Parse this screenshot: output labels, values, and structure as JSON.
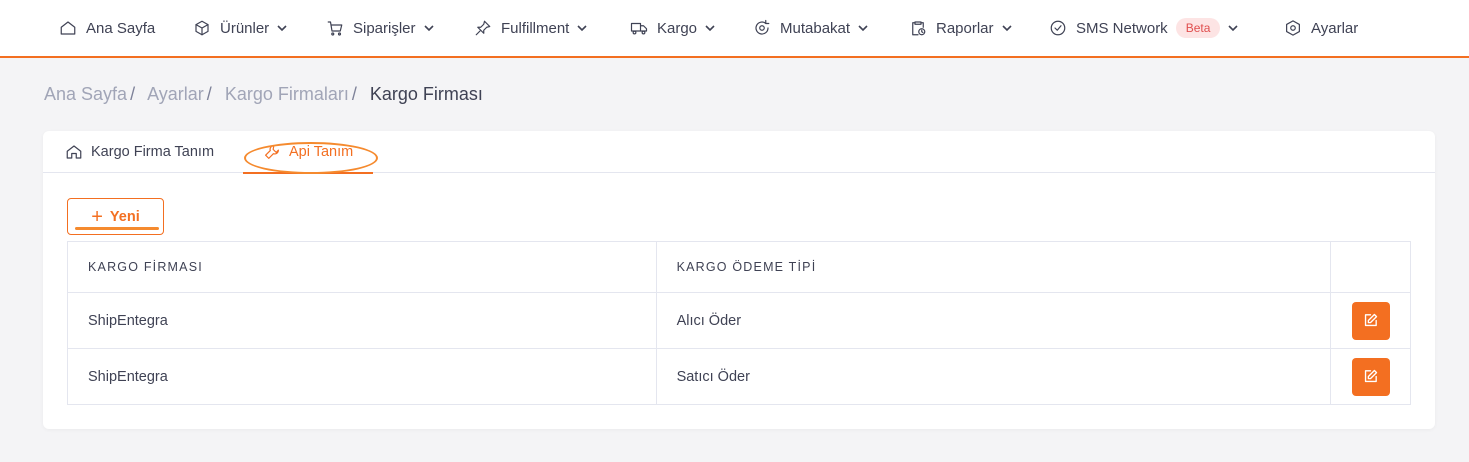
{
  "nav": {
    "items": [
      {
        "label": "Ana Sayfa",
        "icon": "home-icon",
        "dropdown": false
      },
      {
        "label": "Ürünler",
        "icon": "box-icon",
        "dropdown": true
      },
      {
        "label": "Siparişler",
        "icon": "cart-icon",
        "dropdown": true
      },
      {
        "label": "Fulfillment",
        "icon": "pin-icon",
        "dropdown": true
      },
      {
        "label": "Kargo",
        "icon": "truck-icon",
        "dropdown": true
      },
      {
        "label": "Mutabakat",
        "icon": "reconcile-icon",
        "dropdown": true
      },
      {
        "label": "Raporlar",
        "icon": "clipboard-icon",
        "dropdown": true
      },
      {
        "label": "SMS Network",
        "icon": "check-circle-icon",
        "dropdown": true,
        "badge": "Beta"
      },
      {
        "label": "Ayarlar",
        "icon": "settings-icon",
        "dropdown": false
      }
    ]
  },
  "breadcrumb": {
    "items": [
      "Ana Sayfa",
      "Ayarlar",
      "Kargo Firmaları"
    ],
    "current": "Kargo Firması"
  },
  "tabs": [
    {
      "label": "Kargo Firma Tanım",
      "icon": "home-icon",
      "active": false
    },
    {
      "label": "Api Tanım",
      "icon": "wrench-icon",
      "active": true
    }
  ],
  "toolbar": {
    "new_label": "Yeni"
  },
  "table": {
    "headers": [
      "KARGO FİRMASI",
      "KARGO ÖDEME TİPİ",
      ""
    ],
    "rows": [
      {
        "firm": "ShipEntegra",
        "payment_type": "Alıcı Öder"
      },
      {
        "firm": "ShipEntegra",
        "payment_type": "Satıcı Öder"
      }
    ]
  },
  "colors": {
    "accent": "#f36f21",
    "annotation": "#f58a2e",
    "badge_bg": "#fde4e4",
    "badge_text": "#e04e4e"
  }
}
